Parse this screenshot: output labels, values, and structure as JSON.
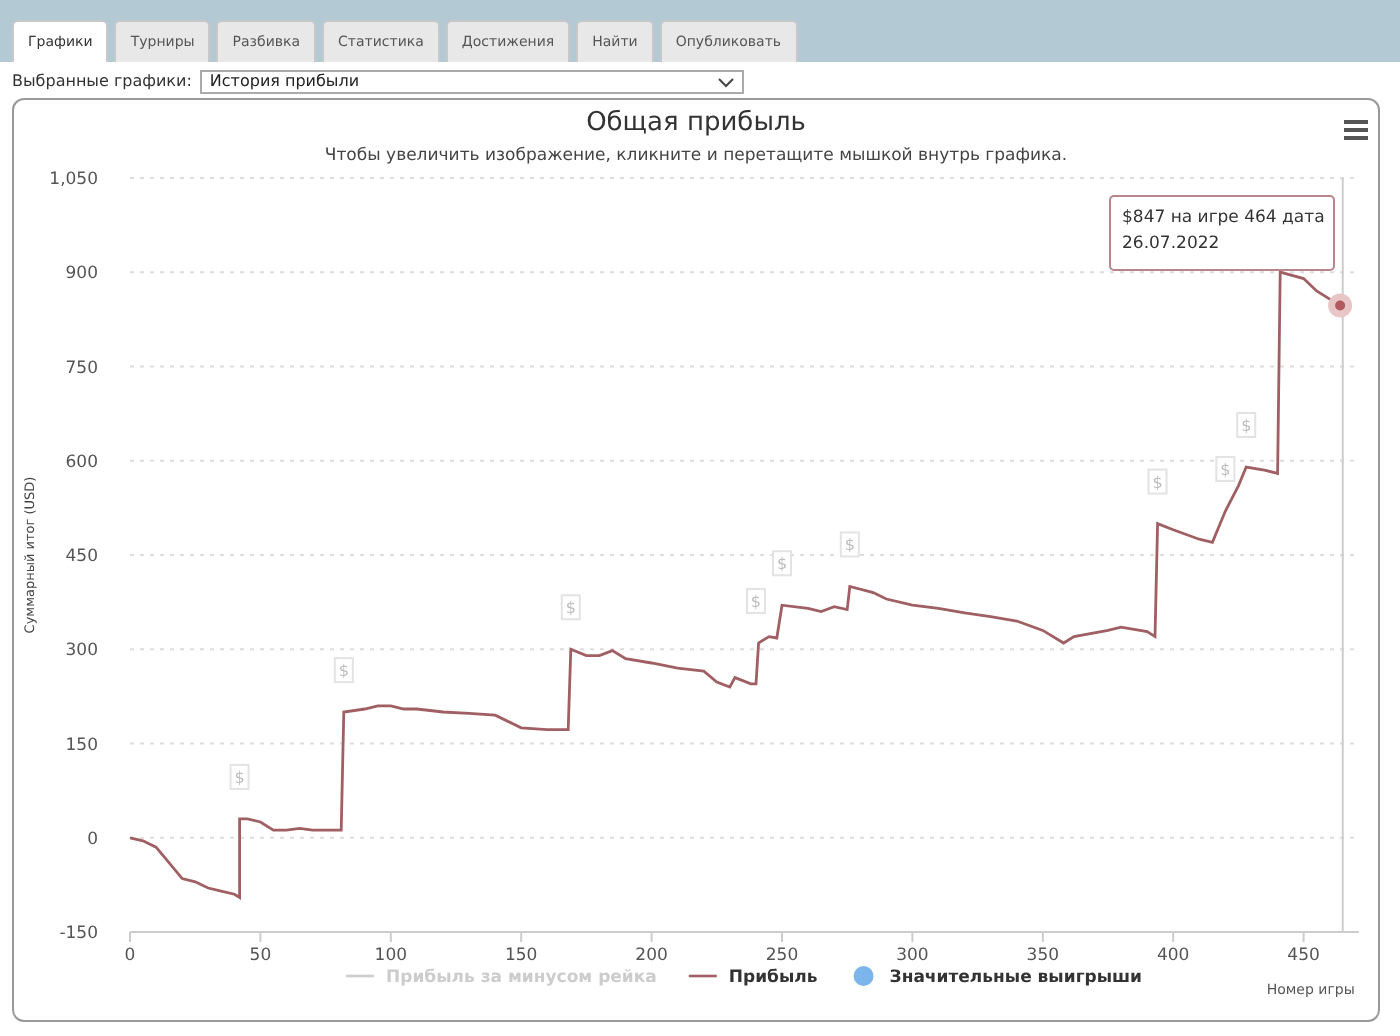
{
  "tabs": [
    {
      "label": "Графики",
      "selected": true
    },
    {
      "label": "Турниры",
      "selected": false
    },
    {
      "label": "Разбивка",
      "selected": false
    },
    {
      "label": "Статистика",
      "selected": false
    },
    {
      "label": "Достижения",
      "selected": false
    },
    {
      "label": "Найти",
      "selected": false
    },
    {
      "label": "Опубликовать",
      "selected": false
    }
  ],
  "chart_select": {
    "label": "Выбранные графики:",
    "value": "История прибыли"
  },
  "chart": {
    "title": "Общая прибыль",
    "subtitle": "Чтобы увеличить изображение, кликните и перетащите мышкой внутрь графика.",
    "legend": [
      {
        "label": "Прибыль за минусом рейка",
        "kind": "line",
        "color": "#cccccc",
        "enabled": false
      },
      {
        "kind": "series",
        "enabled": true
      },
      {
        "label": "Значительные выигрыши",
        "kind": "dot",
        "color": "#7cb5ec",
        "enabled": true
      }
    ],
    "tooltip": {
      "lines": [
        "$847 на игре 464 дата",
        "26.07.2022"
      ]
    },
    "chart_data": {
      "type": "line",
      "grid": true,
      "xlabel": "Номер игры",
      "ylabel": "Суммарный итог (USD)",
      "xlim": [
        0,
        465
      ],
      "ylim": [
        -150,
        1050
      ],
      "xticks": [
        0,
        50,
        100,
        150,
        200,
        250,
        300,
        350,
        400,
        450
      ],
      "yticks": [
        -150,
        0,
        150,
        300,
        450,
        600,
        750,
        900,
        {
          "value": 1050,
          "label": "1,050"
        }
      ],
      "x": [
        0,
        5,
        10,
        15,
        20,
        25,
        30,
        35,
        40,
        42,
        42,
        45,
        50,
        55,
        60,
        65,
        70,
        75,
        81,
        82,
        90,
        95,
        100,
        105,
        110,
        120,
        130,
        140,
        150,
        160,
        168,
        169,
        175,
        180,
        185,
        190,
        200,
        210,
        220,
        225,
        230,
        232,
        238,
        240,
        241,
        245,
        248,
        250,
        260,
        265,
        270,
        275,
        276,
        285,
        290,
        300,
        310,
        320,
        330,
        340,
        350,
        358,
        362,
        375,
        380,
        390,
        393,
        394,
        400,
        410,
        415,
        420,
        425,
        428,
        435,
        440,
        441,
        450,
        455,
        464
      ],
      "series": [
        {
          "name": "Прибыль",
          "color": "#a05f63",
          "values": [
            0,
            -5,
            -15,
            -40,
            -65,
            -70,
            -80,
            -85,
            -90,
            -95,
            30,
            30,
            25,
            12,
            12,
            15,
            12,
            12,
            12,
            200,
            205,
            210,
            210,
            205,
            205,
            200,
            198,
            195,
            175,
            172,
            172,
            300,
            290,
            290,
            298,
            285,
            278,
            270,
            265,
            248,
            240,
            255,
            245,
            245,
            310,
            320,
            318,
            370,
            365,
            360,
            368,
            363,
            400,
            390,
            380,
            370,
            365,
            358,
            352,
            345,
            330,
            310,
            320,
            330,
            335,
            328,
            320,
            500,
            490,
            475,
            470,
            520,
            560,
            590,
            585,
            580,
            900,
            890,
            870,
            847
          ]
        }
      ],
      "annotations": [
        {
          "x": 42,
          "text": "$"
        },
        {
          "x": 82,
          "text": "$"
        },
        {
          "x": 169,
          "text": "$"
        },
        {
          "x": 240,
          "text": "$"
        },
        {
          "x": 250,
          "text": "$"
        },
        {
          "x": 276,
          "text": "$"
        },
        {
          "x": 394,
          "text": "$"
        },
        {
          "x": 420,
          "text": "$"
        },
        {
          "x": 428,
          "text": "$"
        }
      ]
    }
  }
}
